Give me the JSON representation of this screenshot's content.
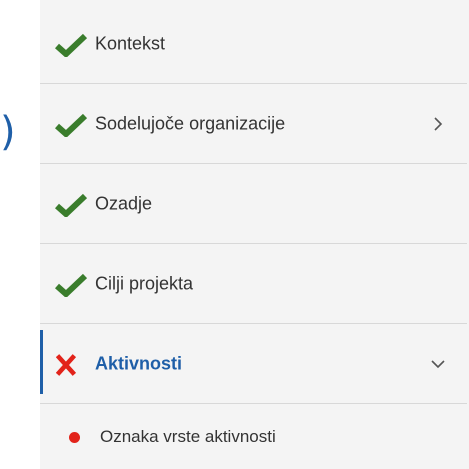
{
  "decoration": {
    "paren": ")"
  },
  "nav": {
    "items": [
      {
        "label": "Kontekst",
        "status": "complete",
        "icon": "checkmark-icon"
      },
      {
        "label": "Sodelujoče organizacije",
        "status": "complete",
        "icon": "checkmark-icon",
        "chevron": "chevron-right-icon"
      },
      {
        "label": "Ozadje",
        "status": "complete",
        "icon": "checkmark-icon"
      },
      {
        "label": "Cilji projekta",
        "status": "complete",
        "icon": "checkmark-icon"
      },
      {
        "label": "Aktivnosti",
        "status": "error",
        "icon": "cross-icon",
        "chevron": "chevron-down-icon",
        "active": true
      }
    ],
    "sub_items": [
      {
        "label": "Oznaka vrste aktivnosti",
        "icon": "red-dot-icon"
      }
    ]
  },
  "colors": {
    "check_green": "#2e7d32",
    "error_red": "#e2231a",
    "active_blue": "#1f5fa8",
    "panel_bg": "#f4f4f4"
  }
}
